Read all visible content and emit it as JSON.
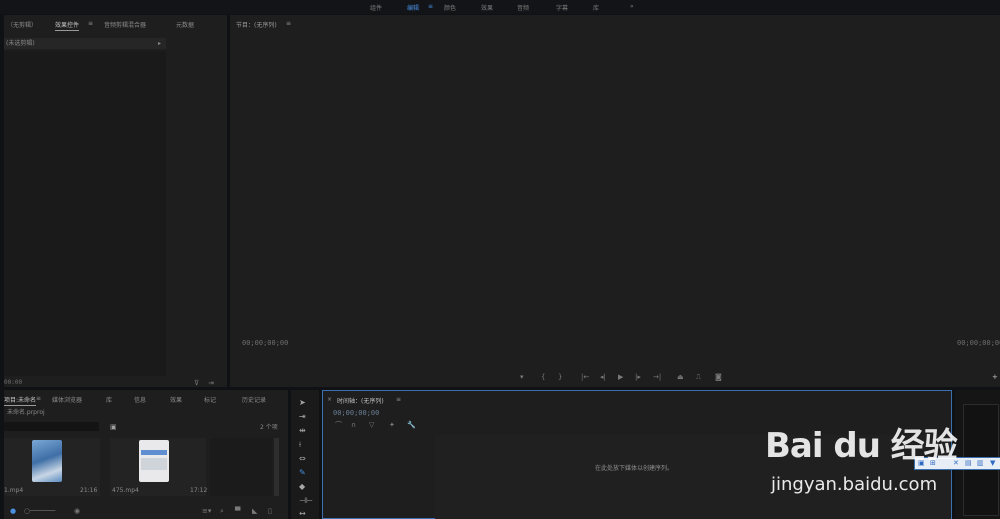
{
  "workspace": {
    "tabs": [
      "组件",
      "编辑",
      "颜色",
      "效果",
      "音频",
      "字幕",
      "库"
    ],
    "active_index": 1,
    "overflow": "»"
  },
  "source_panel": {
    "tabs": [
      "（无剪辑）",
      "效果控件",
      "音频剪辑混合器",
      "元数据"
    ],
    "active_index": 1,
    "dropdown": "(未选剪辑)",
    "timecode": "00:00"
  },
  "program_panel": {
    "title": "节目：(无序列)",
    "timecode_left": "00;00;00;00",
    "timecode_right": "00;00;00;00"
  },
  "project_panel": {
    "tabs": [
      "项目:未命名",
      "媒体浏览器",
      "库",
      "信息",
      "效果",
      "标记",
      "历史记录"
    ],
    "active_index": 0,
    "filename": "未命名.prproj",
    "item_count": "2 个项",
    "clips": [
      {
        "name": "1.mp4",
        "duration": "21:16"
      },
      {
        "name": "475.mp4",
        "duration": "17:12"
      }
    ]
  },
  "timeline_panel": {
    "title": "时间轴：(无序列)",
    "timecode": "00;00;00;00",
    "empty_message": "在此处放下媒体以创建序列。"
  },
  "watermark": {
    "logo_text": "Bai du 经验",
    "url": "jingyan.baidu.com"
  },
  "colors": {
    "accent": "#4a8ee0",
    "panel": "#1e1e1e",
    "background": "#0f1114"
  }
}
